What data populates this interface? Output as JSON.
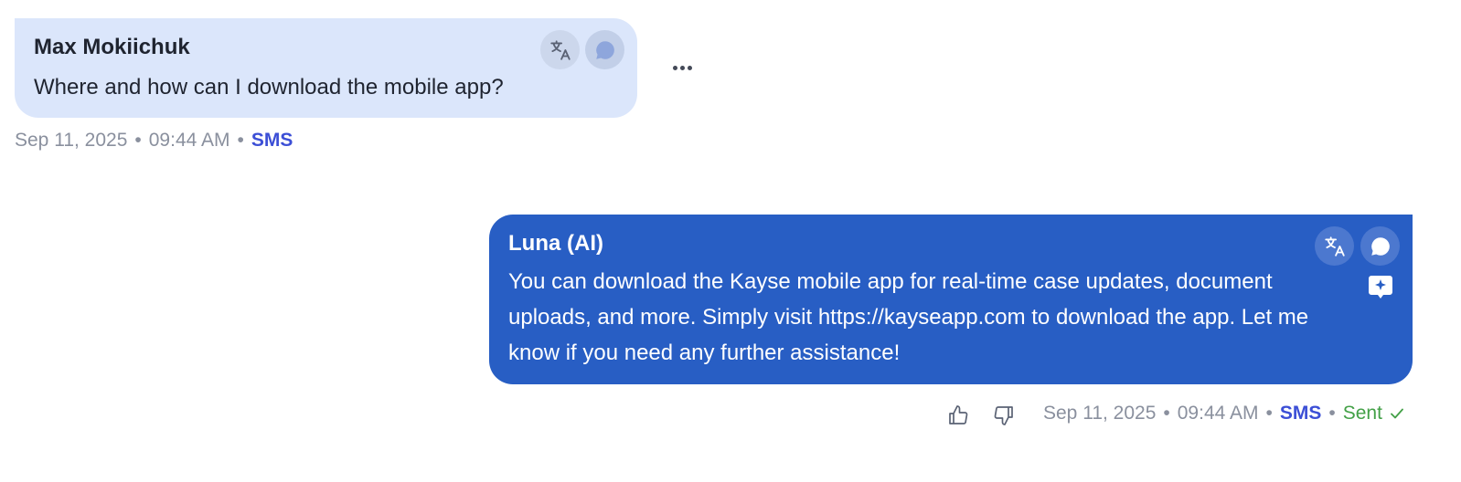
{
  "messages": [
    {
      "sender": "Max Mokiichuk",
      "text": "Where and how can I download the mobile app?",
      "date": "Sep 11, 2025",
      "time": "09:44 AM",
      "channel": "SMS",
      "icons": [
        "translate-icon",
        "chat-bubble-icon",
        "more-options-icon"
      ]
    },
    {
      "sender": "Luna (AI)",
      "text": "You can download the Kayse mobile app for real-time case updates, document uploads, and more. Simply visit https://kayseapp.com to download the app. Let me know if you need any further assistance!",
      "date": "Sep 11, 2025",
      "time": "09:44 AM",
      "channel": "SMS",
      "status": "Sent",
      "icons": [
        "translate-icon",
        "chat-bubble-icon",
        "ai-sparkle-icon",
        "thumbs-up-icon",
        "thumbs-down-icon",
        "checkmark-icon"
      ]
    }
  ],
  "separator": "•",
  "colors": {
    "incoming_bubble": "#dbe6fb",
    "outgoing_bubble": "#285ec4",
    "channel": "#3c4fd6",
    "sent": "#43a047",
    "meta": "#8a909e"
  }
}
